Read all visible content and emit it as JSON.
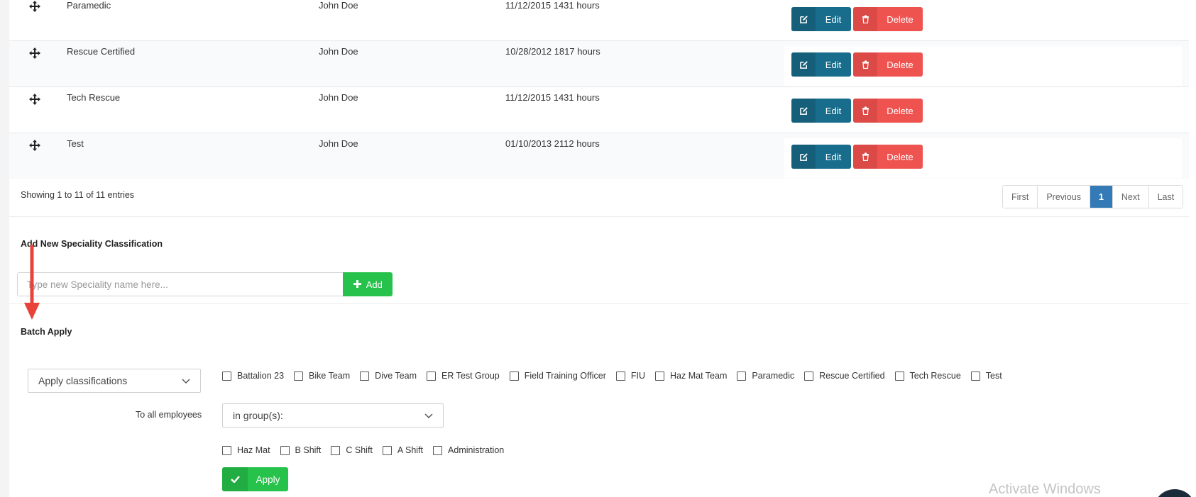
{
  "table": {
    "rows": [
      {
        "name": "Paramedic",
        "user": "John Doe",
        "date": "11/12/2015 1431 hours",
        "edit": "Edit",
        "delete": "Delete"
      },
      {
        "name": "Rescue Certified",
        "user": "John Doe",
        "date": "10/28/2012 1817 hours",
        "edit": "Edit",
        "delete": "Delete"
      },
      {
        "name": "Tech Rescue",
        "user": "John Doe",
        "date": "11/12/2015 1431 hours",
        "edit": "Edit",
        "delete": "Delete"
      },
      {
        "name": "Test",
        "user": "John Doe",
        "date": "01/10/2013 2112 hours",
        "edit": "Edit",
        "delete": "Delete"
      }
    ],
    "entries_text": "Showing 1 to 11 of 11 entries",
    "pagination": {
      "first": "First",
      "previous": "Previous",
      "current": "1",
      "next": "Next",
      "last": "Last"
    }
  },
  "add_new": {
    "title": "Add New Speciality Classification",
    "placeholder": "Type new Speciality name here...",
    "button_label": "Add"
  },
  "batch": {
    "title": "Batch Apply",
    "classification_select": "Apply classifications",
    "classifications": [
      "Battalion 23",
      "Bike Team",
      "Dive Team",
      "ER Test Group",
      "Field Training Officer",
      "FIU",
      "Haz Mat Team",
      "Paramedic",
      "Rescue Certified",
      "Tech Rescue",
      "Test"
    ],
    "to_all_label": "To all employees",
    "group_select": "in group(s):",
    "groups": [
      "Haz Mat",
      "B Shift",
      "C Shift",
      "A Shift",
      "Administration"
    ],
    "apply_label": "Apply"
  },
  "watermark": "Activate Windows",
  "colors": {
    "edit": "#196d8c",
    "delete": "#ef5350",
    "add": "#27c24c",
    "pager_active": "#337ab7",
    "arrow": "#e8423a"
  }
}
